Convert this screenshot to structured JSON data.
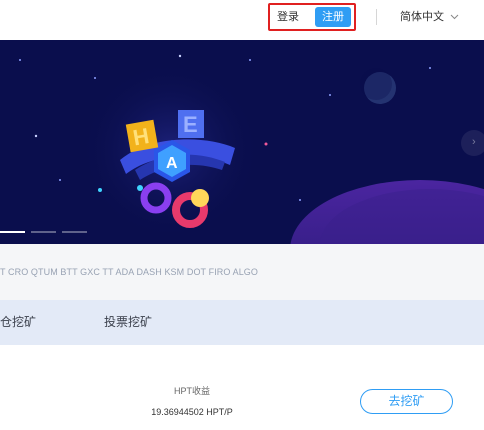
{
  "header": {
    "login_label": "登录",
    "register_label": "注册",
    "language_label": "简体中文"
  },
  "banner": {
    "slide_count": 3,
    "active_slide": 1
  },
  "ticker": {
    "text": "T CRO QTUM BTT GXC TT ADA DASH KSM DOT FIRO ALGO"
  },
  "tabs": [
    {
      "label": "仓挖矿"
    },
    {
      "label": "投票挖矿"
    }
  ],
  "earnings": {
    "title": "HPT收益",
    "value": "19.36944502 HPT/P",
    "action_label": "去挖矿"
  },
  "colors": {
    "accent": "#2f9df4",
    "banner_bg": "#0a0e4d",
    "highlight": "#e02020",
    "tab_bar": "#e3eaf7"
  }
}
